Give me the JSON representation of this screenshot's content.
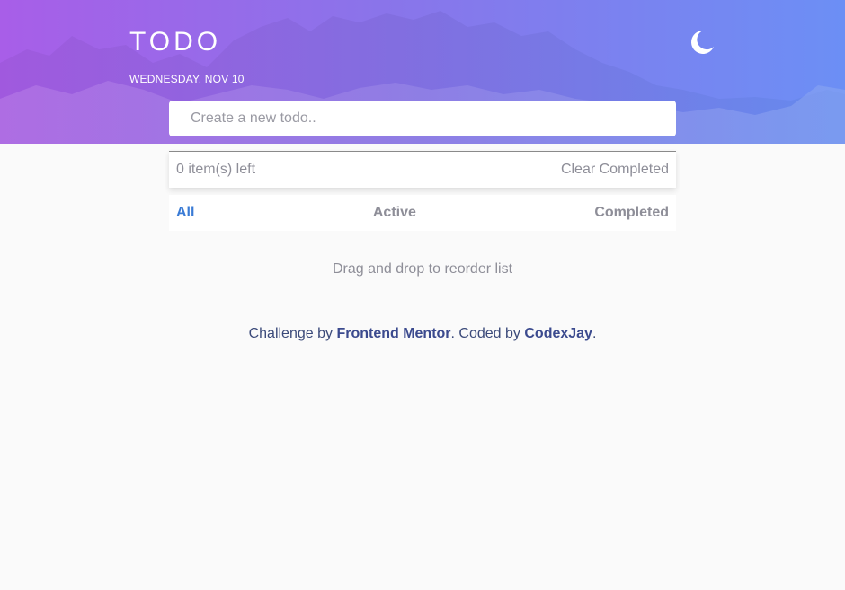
{
  "header": {
    "title": "TODO",
    "date": "WEDNESDAY, NOV 10",
    "theme_toggle_icon": "moon-icon",
    "gradient": [
      "#a85ee8",
      "#6c8ff5"
    ]
  },
  "new_todo": {
    "placeholder": "Create a new todo..",
    "value": ""
  },
  "status": {
    "items_left": "0 item(s) left",
    "clear_label": "Clear Completed"
  },
  "filters": {
    "all": "All",
    "active": "Active",
    "completed": "Completed",
    "selected": "All",
    "accent": "#3a7bd5"
  },
  "hint": "Drag and drop to reorder list",
  "footer": {
    "prefix": "Challenge by ",
    "mentor_link": "Frontend Mentor",
    "middle": ". Coded by ",
    "author_link": "CodexJay",
    "suffix": "."
  }
}
